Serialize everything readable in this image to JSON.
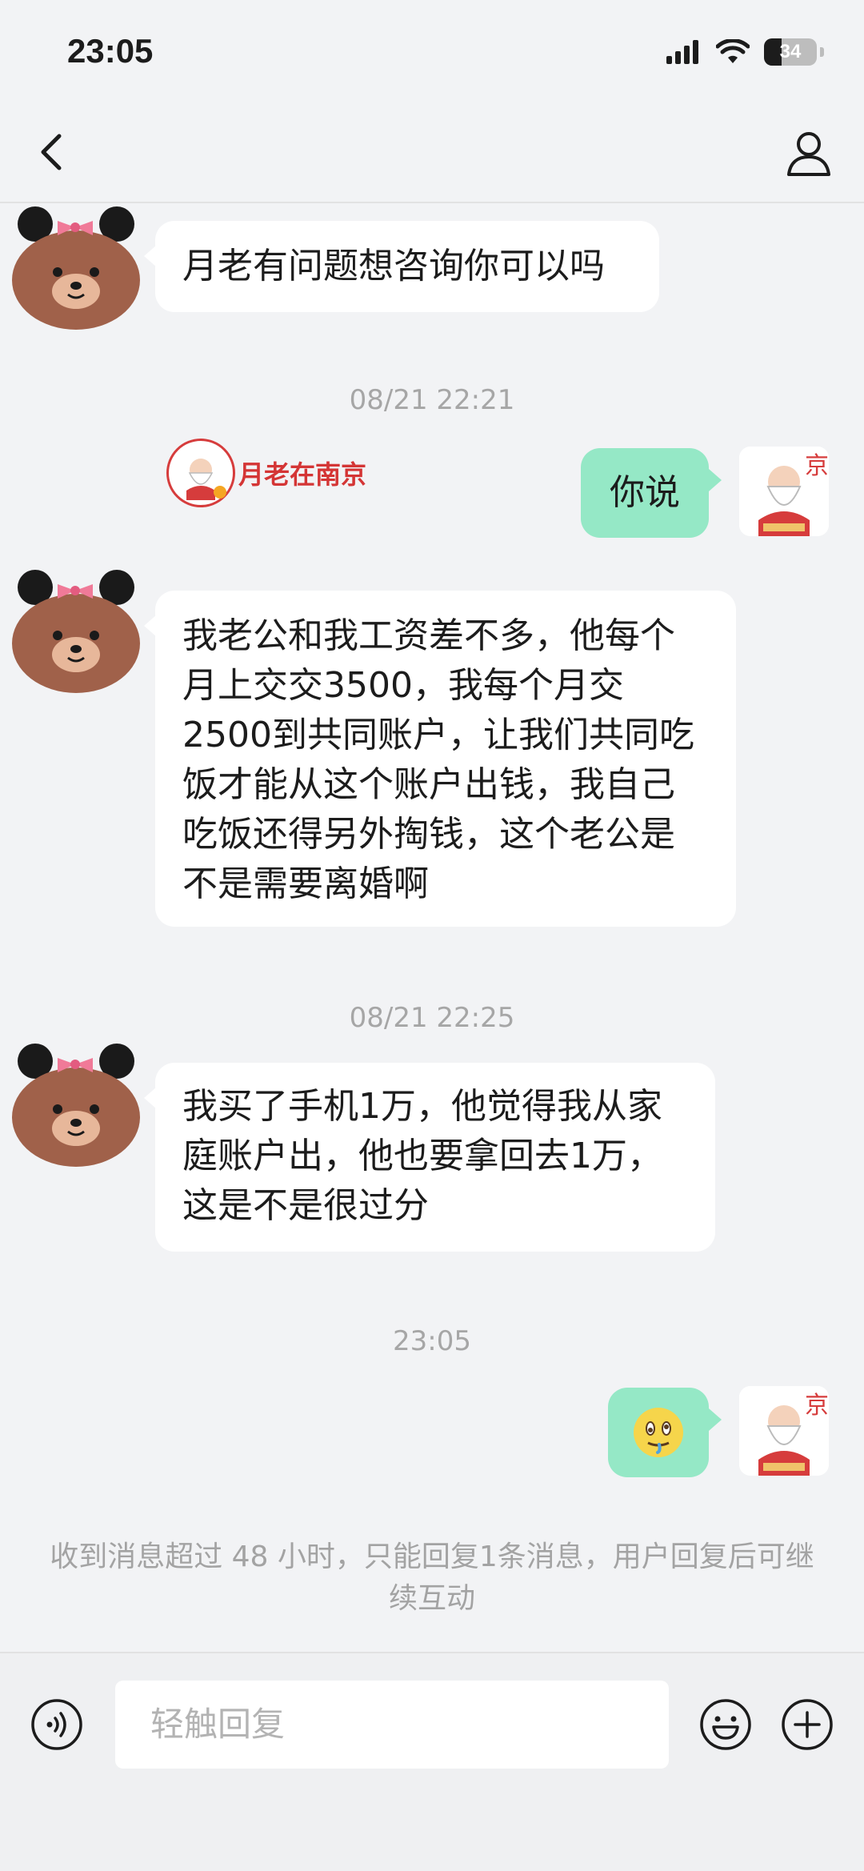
{
  "status_bar": {
    "time": "23:05",
    "battery": "34"
  },
  "header": {
    "contact_name": ""
  },
  "messages": [
    {
      "text": "月老有问题想咨询你可以吗"
    },
    {
      "timestamp": "08/21 22:21"
    },
    {
      "text": "你说"
    },
    {
      "text": "我老公和我工资差不多，他每个月上交交3500，我每个月交2500到共同账户，让我们共同吃饭才能从这个账户出钱，我自己吃饭还得另外掏钱，这个老公是不是需要离婚啊"
    },
    {
      "timestamp": "08/21 22:25"
    },
    {
      "text": "我买了手机1万，他觉得我从家庭账户出，他也要拿回去1万，这是不是很过分"
    },
    {
      "timestamp": "23:05"
    }
  ],
  "brand": {
    "name": "月老在南京"
  },
  "notice": "收到消息超过 48 小时，只能回复1条消息，用户回复后可继续互动",
  "input": {
    "placeholder": "轻触回复"
  },
  "colors": {
    "my_bubble": "#95e8c6",
    "their_bubble": "#ffffff",
    "background": "#f2f3f5",
    "brand_red": "#d43535"
  },
  "icons": [
    "back-icon",
    "profile-icon",
    "voice-icon",
    "emoji-icon",
    "plus-icon",
    "signal-icon",
    "wifi-icon",
    "battery-icon"
  ]
}
